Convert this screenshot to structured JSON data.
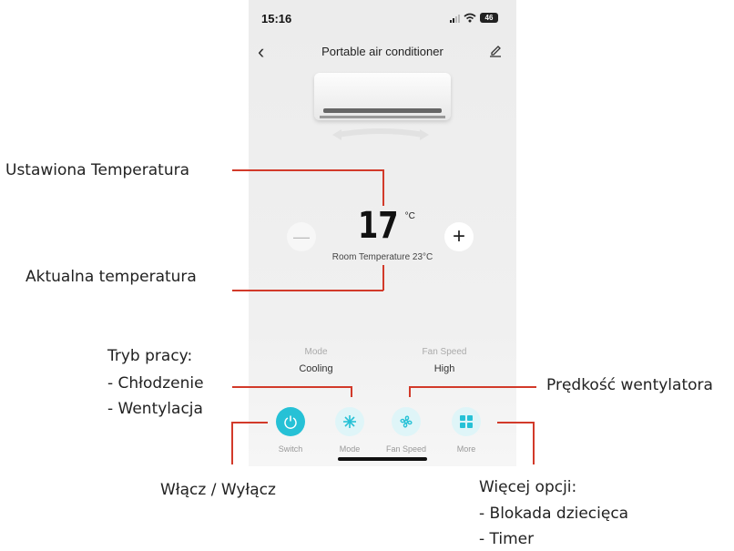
{
  "status_bar": {
    "time": "15:16",
    "battery": "46"
  },
  "nav": {
    "back_symbol": "‹",
    "title": "Portable air conditioner"
  },
  "temperature": {
    "value": "17",
    "unit": "°C",
    "room": "Room Temperature 23°C"
  },
  "controls": {
    "minus_symbol": "—",
    "plus_symbol": "+"
  },
  "mode": {
    "label": "Mode",
    "value": "Cooling"
  },
  "fan_speed": {
    "label": "Fan Speed",
    "value": "High"
  },
  "bottom_bar": [
    {
      "label": "Switch",
      "icon": "power-icon",
      "color": "#26c1d6"
    },
    {
      "label": "Mode",
      "icon": "snowflake-icon",
      "color": "#dff5f8"
    },
    {
      "label": "Fan Speed",
      "icon": "fan-icon",
      "color": "#dff5f8"
    },
    {
      "label": "More",
      "icon": "grid-icon",
      "color": "#dff5f8"
    }
  ],
  "annotations": {
    "set_temp": "Ustawiona Temperatura",
    "current_temp": "Aktualna temperatura",
    "mode_line1": "Tryb pracy:",
    "mode_line2": "- Chłodzenie",
    "mode_line3": "- Wentylacja",
    "fan_speed": "Prędkość wentylatora",
    "power": "Włącz / Wyłącz",
    "more_line1": "Więcej opcji:",
    "more_line2": "- Blokada dziecięca",
    "more_line3": "- Timer"
  },
  "colors": {
    "accent": "#26c1d6",
    "annotation_line": "#d23a2a"
  }
}
